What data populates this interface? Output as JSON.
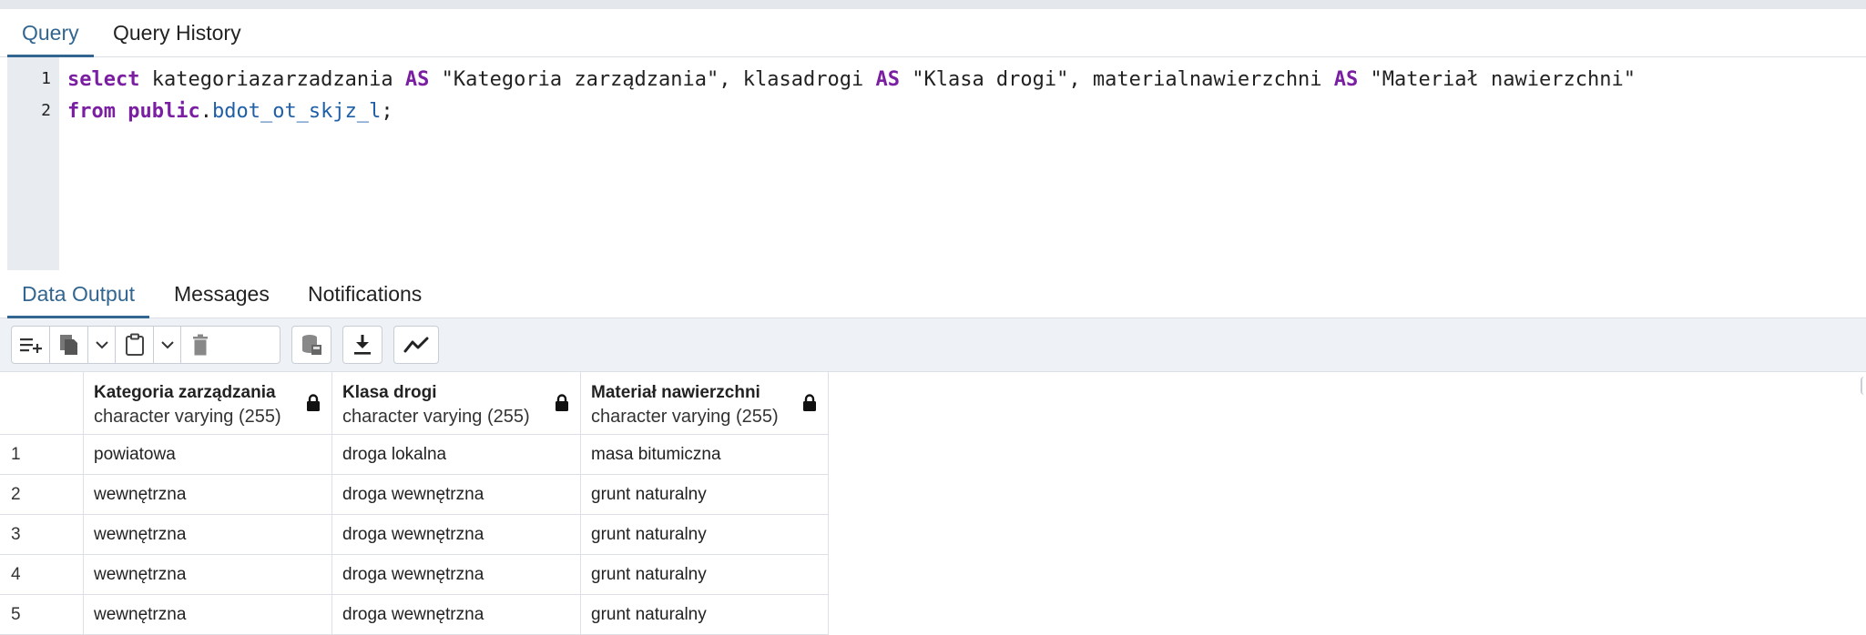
{
  "query_tabs": [
    "Query",
    "Query History"
  ],
  "editor": {
    "line_numbers": [
      "1",
      "2"
    ],
    "line1": [
      {
        "t": "select",
        "c": "kw"
      },
      {
        "t": " kategoriazarzadzania ",
        "c": ""
      },
      {
        "t": "AS",
        "c": "kw"
      },
      {
        "t": " \"Kategoria zarządzania\", klasadrogi ",
        "c": ""
      },
      {
        "t": "AS",
        "c": "kw"
      },
      {
        "t": " \"Klasa drogi\", materialnawierzchni ",
        "c": ""
      },
      {
        "t": "AS",
        "c": "kw"
      },
      {
        "t": " \"Materiał nawierzchni\"",
        "c": ""
      }
    ],
    "line2": [
      {
        "t": "from",
        "c": "kw"
      },
      {
        "t": " ",
        "c": ""
      },
      {
        "t": "public",
        "c": "kw"
      },
      {
        "t": ".",
        "c": ""
      },
      {
        "t": "bdot_ot_skjz_l",
        "c": "tbl"
      },
      {
        "t": ";",
        "c": ""
      }
    ]
  },
  "output_tabs": [
    "Data Output",
    "Messages",
    "Notifications"
  ],
  "toolbar": {
    "buttons": [
      "add-row-icon",
      "copy-icon",
      "chevron-down-icon",
      "paste-icon",
      "chevron-down-icon",
      "delete-icon",
      "save-data-icon",
      "download-icon",
      "graph-icon"
    ]
  },
  "grid": {
    "columns": [
      {
        "name": "Kategoria zarządzania",
        "type": "character varying (255)"
      },
      {
        "name": "Klasa drogi",
        "type": "character varying (255)"
      },
      {
        "name": "Materiał nawierzchni",
        "type": "character varying (255)"
      }
    ],
    "rows": [
      [
        "1",
        "powiatowa",
        "droga lokalna",
        "masa bitumiczna"
      ],
      [
        "2",
        "wewnętrzna",
        "droga wewnętrzna",
        "grunt naturalny"
      ],
      [
        "3",
        "wewnętrzna",
        "droga wewnętrzna",
        "grunt naturalny"
      ],
      [
        "4",
        "wewnętrzna",
        "droga wewnętrzna",
        "grunt naturalny"
      ],
      [
        "5",
        "wewnętrzna",
        "droga wewnętrzna",
        "grunt naturalny"
      ]
    ]
  },
  "colors": {
    "accent": "#326690",
    "keyword": "#7b1fa2",
    "table": "#1f5fa8"
  }
}
